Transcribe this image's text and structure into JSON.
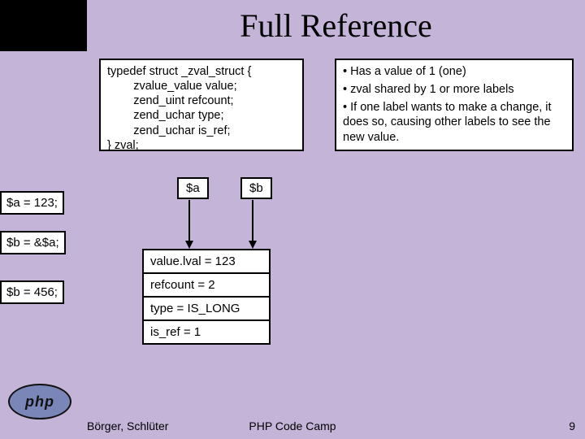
{
  "title": "Full Reference",
  "struct": {
    "l1": "typedef struct _zval_struct {",
    "l2": "        zvalue_value value;",
    "l3": "        zend_uint refcount;",
    "l4": "        zend_uchar type;",
    "l5": "        zend_uchar is_ref;",
    "l6": "} zval;"
  },
  "bullets": {
    "b1": "• Has a value of 1 (one)",
    "b2": "• zval shared by 1 or more labels",
    "b3": "• If one label wants to make a change, it does so, causing other labels to see the new value."
  },
  "assigns": {
    "a1": "$a = 123;",
    "a2": "$b = &$a;",
    "a3": "$b = 456;"
  },
  "vars": {
    "a": "$a",
    "b": "$b"
  },
  "zval": {
    "r1": "value.lval = 123",
    "r2": "refcount = 2",
    "r3": "type = IS_LONG",
    "r4": "is_ref = 1"
  },
  "logo": "php",
  "footer": {
    "left": "Börger, Schlüter",
    "center": "PHP Code Camp",
    "right": "9"
  }
}
